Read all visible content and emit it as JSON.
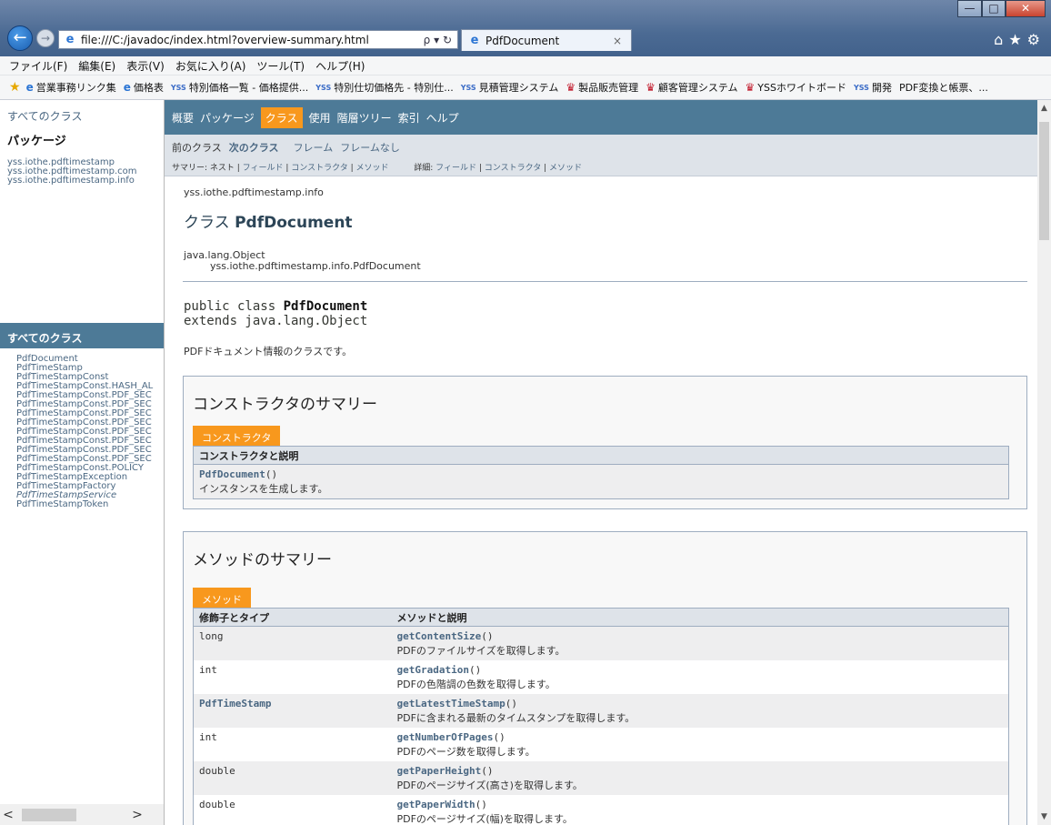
{
  "browser": {
    "url": "file:///C:/javadoc/index.html?overview-summary.html",
    "address_controls": "ρ ▾ ↻",
    "tab_title": "PdfDocument",
    "tab_close": "×",
    "back_glyph": "←",
    "forward_glyph": "→",
    "win_min": "—",
    "win_max": "□",
    "win_close": "✕",
    "right_icons": "⌂★⚙"
  },
  "menubar": {
    "items": [
      "ファイル(F)",
      "編集(E)",
      "表示(V)",
      "お気に入り(A)",
      "ツール(T)",
      "ヘルプ(H)"
    ]
  },
  "favorites": {
    "items": [
      {
        "icon": "e",
        "label": "営業事務リンク集"
      },
      {
        "icon": "e",
        "label": "価格表"
      },
      {
        "icon": "yss",
        "label": "特別価格一覧 - 価格提供..."
      },
      {
        "icon": "yss",
        "label": "特別仕切価格先 - 特別仕..."
      },
      {
        "icon": "yss",
        "label": "見積管理システム"
      },
      {
        "icon": "mk",
        "label": "製品販売管理"
      },
      {
        "icon": "mk",
        "label": "顧客管理システム"
      },
      {
        "icon": "mk",
        "label": "YSSホワイトボード"
      },
      {
        "icon": "yss",
        "label": "開発"
      },
      {
        "icon": "",
        "label": "PDF変換と帳票、..."
      }
    ]
  },
  "left_top": {
    "all_classes_link": "すべてのクラス",
    "heading": "パッケージ",
    "packages": [
      "yss.iothe.pdftimestamp",
      "yss.iothe.pdftimestamp.com",
      "yss.iothe.pdftimestamp.info"
    ]
  },
  "left_bottom": {
    "header": "すべてのクラス",
    "classes": [
      "PdfDocument",
      "PdfTimeStamp",
      "PdfTimeStampConst",
      "PdfTimeStampConst.HASH_AL",
      "PdfTimeStampConst.PDF_SEC",
      "PdfTimeStampConst.PDF_SEC",
      "PdfTimeStampConst.PDF_SEC",
      "PdfTimeStampConst.PDF_SEC",
      "PdfTimeStampConst.PDF_SEC",
      "PdfTimeStampConst.PDF_SEC",
      "PdfTimeStampConst.PDF_SEC",
      "PdfTimeStampConst.PDF_SEC",
      "PdfTimeStampConst.POLICY",
      "PdfTimeStampException",
      "PdfTimeStampFactory",
      "PdfTimeStampService",
      "PdfTimeStampToken"
    ],
    "scroll_left": "<",
    "scroll_right": ">"
  },
  "topnav": {
    "items": [
      "概要",
      "パッケージ",
      "クラス",
      "使用",
      "階層ツリー",
      "索引",
      "ヘルプ"
    ],
    "active_index": 2
  },
  "subnav": {
    "prev": "前のクラス",
    "next": "次のクラス",
    "frames": "フレーム",
    "no_frames": "フレームなし",
    "summary_prefix": "サマリー: ネスト | ",
    "summary_field": "フィールド",
    "summary_sep1": " | ",
    "summary_ctor": "コンストラクタ",
    "summary_sep2": " | ",
    "summary_method": "メソッド",
    "detail_prefix": "詳細: ",
    "detail_field": "フィールド",
    "detail_sep1": " | ",
    "detail_ctor": "コンストラクタ",
    "detail_sep2": " | ",
    "detail_method": "メソッド"
  },
  "class_info": {
    "package": "yss.iothe.pdftimestamp.info",
    "title_prefix": "クラス ",
    "title_name": "PdfDocument",
    "inherit_parent": "java.lang.Object",
    "inherit_child": "yss.iothe.pdftimestamp.info.PdfDocument",
    "decl_prefix": "public class ",
    "decl_name": "PdfDocument",
    "decl_extends": "extends java.lang.Object",
    "description": "PDFドキュメント情報のクラスです。"
  },
  "ctor_summary": {
    "title": "コンストラクタのサマリー",
    "tab": "コンストラクタ",
    "header": "コンストラクタと説明",
    "name": "PdfDocument",
    "parens": "()",
    "desc": "インスタンスを生成します。"
  },
  "method_summary": {
    "title": "メソッドのサマリー",
    "tab": "メソッド",
    "header_col1": "修飾子とタイプ",
    "header_col2": "メソッドと説明",
    "rows": [
      {
        "type": "long",
        "name": "getContentSize",
        "parens": "()",
        "desc": "PDFのファイルサイズを取得します。"
      },
      {
        "type": "int",
        "name": "getGradation",
        "parens": "()",
        "desc": "PDFの色階調の色数を取得します。"
      },
      {
        "type": "PdfTimeStamp",
        "name": "getLatestTimeStamp",
        "parens": "()",
        "desc": "PDFに含まれる最新のタイムスタンプを取得します。"
      },
      {
        "type": "int",
        "name": "getNumberOfPages",
        "parens": "()",
        "desc": "PDFのページ数を取得します。"
      },
      {
        "type": "double",
        "name": "getPaperHeight",
        "parens": "()",
        "desc": "PDFのページサイズ(高さ)を取得します。"
      },
      {
        "type": "double",
        "name": "getPaperWidth",
        "parens": "()",
        "desc": "PDFのページサイズ(幅)を取得します。"
      }
    ]
  },
  "scrollbar": {
    "up": "▲",
    "down": "▼"
  },
  "colors": {
    "nav_bg": "#4d7a97",
    "accent_orange": "#f8981d",
    "link_blue": "#4a6782",
    "subnav_bg": "#dee3e9"
  }
}
